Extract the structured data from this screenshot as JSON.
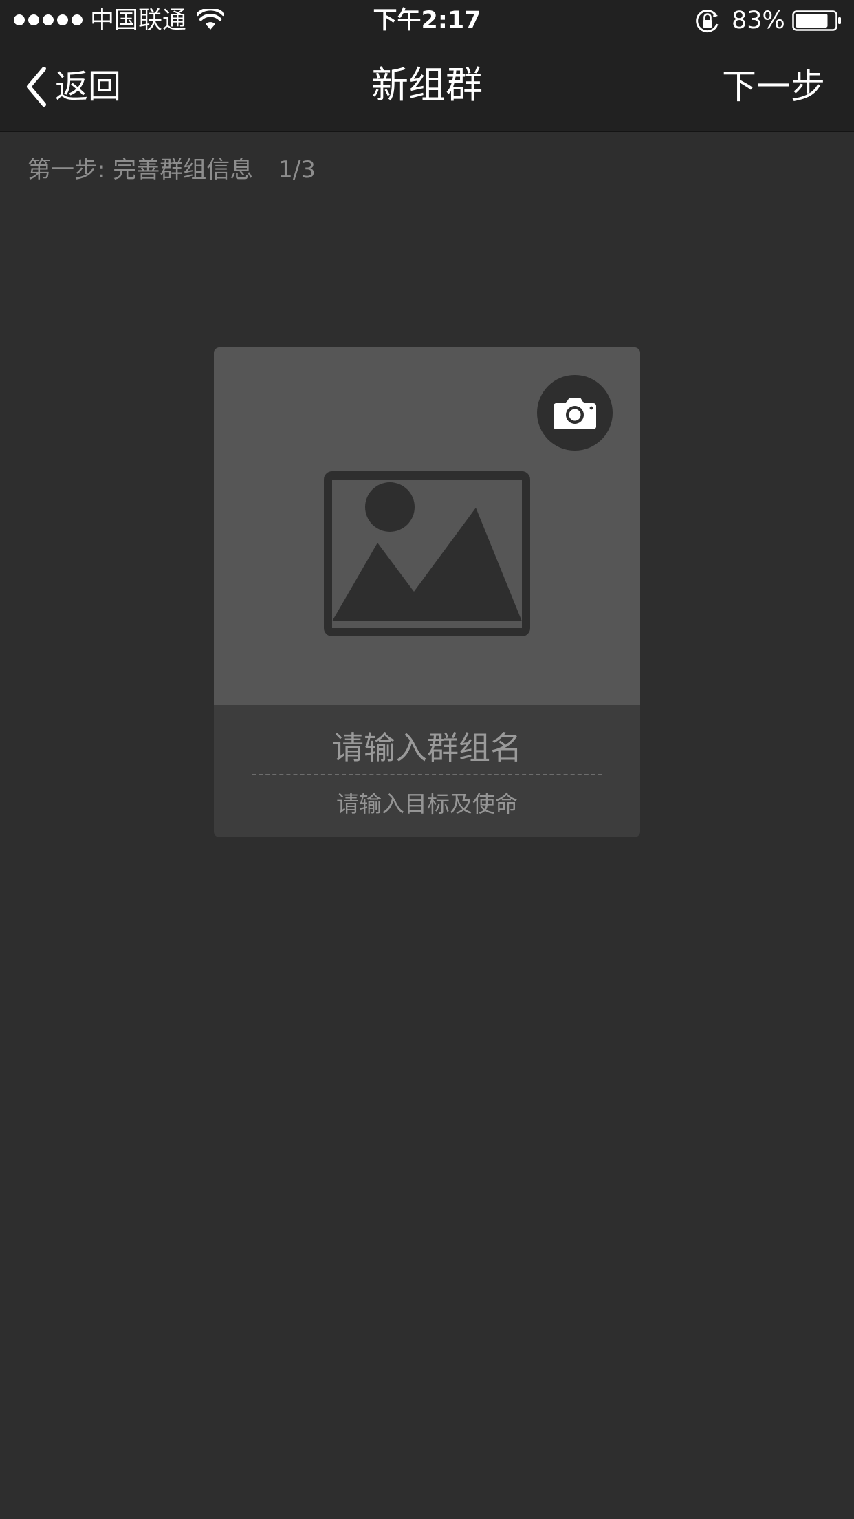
{
  "status_bar": {
    "carrier": "中国联通",
    "time": "下午2:17",
    "battery_percent": "83%",
    "battery_level": 0.83,
    "icons": [
      "signal-dots",
      "wifi-icon",
      "lock-rotation-icon",
      "battery-icon"
    ]
  },
  "nav": {
    "back_label": "返回",
    "title": "新组群",
    "next_label": "下一步"
  },
  "step": {
    "label": "第一步: 完善群组信息",
    "count": "1/3"
  },
  "card": {
    "camera_icon": "camera-icon",
    "placeholder_icon": "image-placeholder-icon",
    "group_name_placeholder": "请输入群组名",
    "group_name_value": "",
    "mission_placeholder": "请输入目标及使命",
    "mission_value": ""
  },
  "colors": {
    "background": "#2e2e2e",
    "bars": "#212121",
    "cover": "#565656",
    "info_panel": "#3d3d3d",
    "text_primary": "#ffffff",
    "text_secondary": "#8d8d8d"
  }
}
